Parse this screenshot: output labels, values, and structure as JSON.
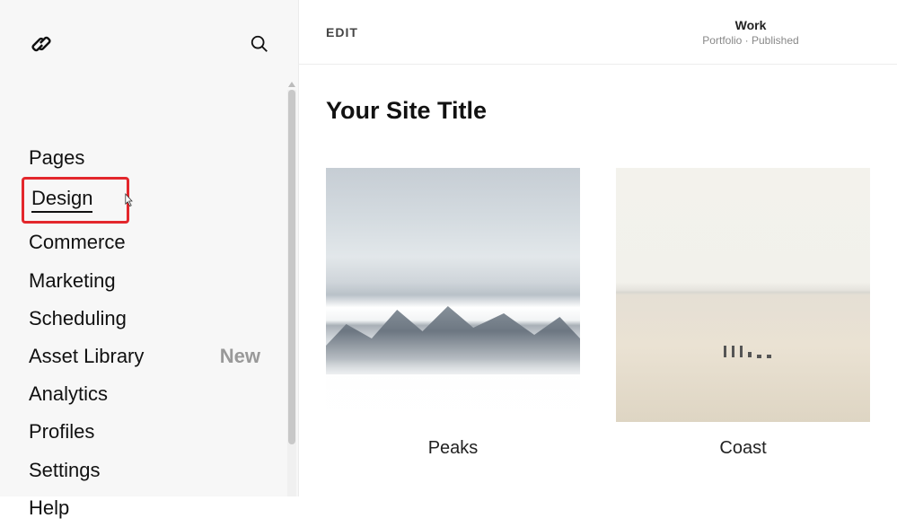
{
  "sidebar": {
    "items": [
      {
        "label": "Pages",
        "name": "nav-pages"
      },
      {
        "label": "Design",
        "name": "nav-design",
        "selected": true
      },
      {
        "label": "Commerce",
        "name": "nav-commerce"
      },
      {
        "label": "Marketing",
        "name": "nav-marketing"
      },
      {
        "label": "Scheduling",
        "name": "nav-scheduling"
      },
      {
        "label": "Asset Library",
        "name": "nav-asset-library",
        "badge": "New"
      },
      {
        "label": "Analytics",
        "name": "nav-analytics"
      },
      {
        "label": "Profiles",
        "name": "nav-profiles"
      },
      {
        "label": "Settings",
        "name": "nav-settings"
      },
      {
        "label": "Help",
        "name": "nav-help"
      }
    ]
  },
  "topbar": {
    "edit_label": "EDIT",
    "page_title": "Work",
    "page_subtitle": "Portfolio · Published"
  },
  "content": {
    "site_title": "Your Site Title",
    "cards": [
      {
        "label": "Peaks",
        "name": "portfolio-card-peaks"
      },
      {
        "label": "Coast",
        "name": "portfolio-card-coast"
      }
    ]
  }
}
